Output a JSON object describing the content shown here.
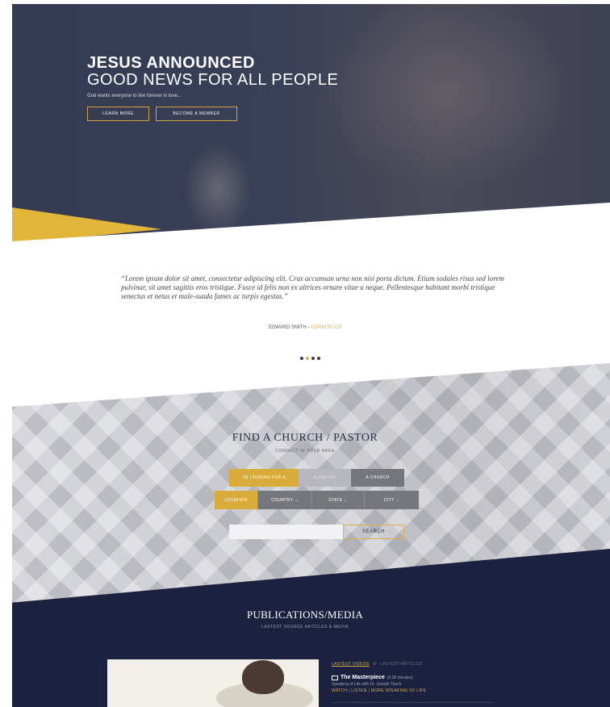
{
  "hero": {
    "title_line1": "JESUS ANNOUNCED",
    "title_line2": "GOOD NEWS FOR ALL PEOPLE",
    "subtitle": "God wants everyone to live forever in love...",
    "learn_more": "LEARN MORE",
    "become_member": "BECOME A MEMBER"
  },
  "quote": {
    "text": "“Lorem ipsum dolor sit amet, consectetur adipiscing elit. Cras accumsan urna non nisi porta dictum. Etiam sodales risus sed lorem pulvinar, sit amet sagittis eros tristique. Fusce id felis non ex ultrices ornare vitae a neque. Pellentesque habitant morbi tristique senectus et netus et male-suada fames ac turpis egestas.”",
    "author": "EDWARD SMITH",
    "author_separator": " - ",
    "author_role": "CORINTH CO"
  },
  "find": {
    "title": "FIND A CHURCH / PASTOR",
    "subtitle": "CONNECT IN YOUR AREA",
    "looking_for": "I'M LOOKING FOR A",
    "pastor": "A PASTOR",
    "church": "A CHURCH",
    "location": "LOCATION",
    "country": "COUNTRY",
    "state": "STATE",
    "city": "CITY",
    "search_placeholder": "",
    "search_button": "SEARCH"
  },
  "publications": {
    "title": "PUBLICATIONS/MEDIA",
    "subtitle": "LASTEST SOURCE ARTICLES & MEDIA",
    "tab_videos": "LASTEST VIDEOS",
    "tab_separator": "//",
    "tab_articles": "LASTEST ARTICLES",
    "item_title": "The Masterpiece",
    "item_duration": "(5:35 minutes)",
    "item_desc": "Speaking of Life with Dr. Joseph Tkach",
    "link_watch": "WATCH",
    "link_listen": "LISTEN",
    "link_more": "MORE SPEAKING OF LIFE",
    "link_pipe": "|"
  },
  "icons": {
    "chevron": "chevron-down-icon",
    "monitor": "monitor-icon"
  },
  "colors": {
    "accent_gold": "#d8b052",
    "navy": "#1c2140"
  }
}
